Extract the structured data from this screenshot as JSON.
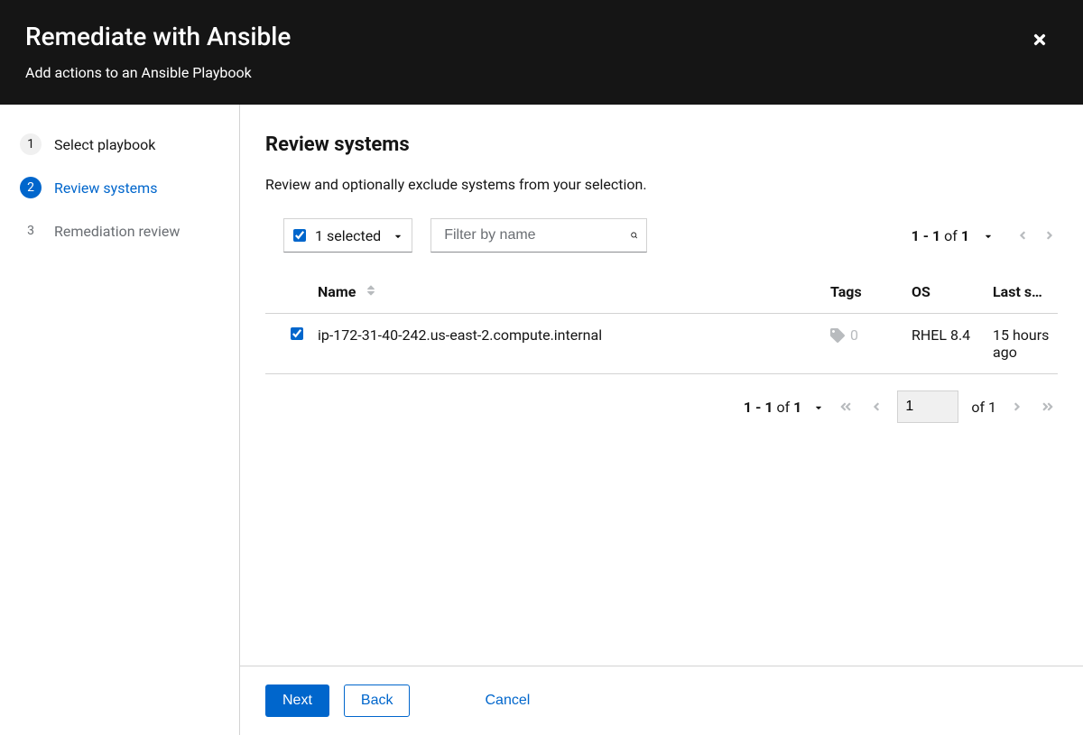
{
  "header": {
    "title": "Remediate with Ansible",
    "subtitle": "Add actions to an Ansible Playbook"
  },
  "wizard": {
    "steps": [
      {
        "num": "1",
        "label": "Select playbook"
      },
      {
        "num": "2",
        "label": "Review systems"
      },
      {
        "num": "3",
        "label": "Remediation review"
      }
    ]
  },
  "main": {
    "title": "Review systems",
    "description": "Review and optionally exclude systems from your selection.",
    "selected_label": "1 selected",
    "filter_placeholder": "Filter by name",
    "columns": {
      "name": "Name",
      "tags": "Tags",
      "os": "OS",
      "last": "Last s…"
    },
    "rows": [
      {
        "name": "ip-172-31-40-242.us-east-2.compute.internal",
        "tag_count": "0",
        "os": "RHEL 8.4",
        "last": "15 hours ago"
      }
    ],
    "pagination_top": {
      "range": "1 - 1",
      "of_word": "of",
      "total": "1"
    },
    "pagination_bottom": {
      "range": "1 - 1",
      "of_word": "of",
      "total": "1",
      "page_value": "1",
      "page_of_word": "of",
      "page_total": "1"
    }
  },
  "footer": {
    "next": "Next",
    "back": "Back",
    "cancel": "Cancel"
  }
}
